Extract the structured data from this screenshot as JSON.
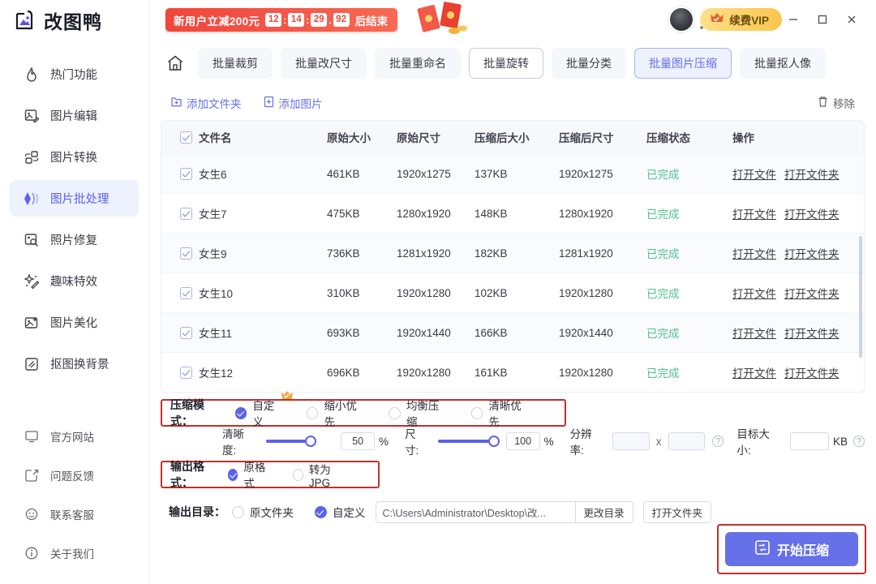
{
  "app": {
    "logo_text": "改图鸭"
  },
  "promo": {
    "text": "新用户立减200元",
    "hours": "12",
    "minutes": "14",
    "seconds": "29",
    "millis": "92",
    "sep": ":",
    "dot": ".",
    "end_text": "后结束"
  },
  "titlebar": {
    "vip_label": "续费VIP",
    "minimize": "—",
    "maximize": "▢",
    "close": "✕"
  },
  "sidebar": {
    "items": [
      {
        "label": "热门功能",
        "icon": "flame-icon",
        "active": false
      },
      {
        "label": "图片编辑",
        "icon": "image-edit-icon",
        "active": false
      },
      {
        "label": "图片转换",
        "icon": "image-convert-icon",
        "active": false
      },
      {
        "label": "图片批处理",
        "icon": "batch-process-icon",
        "active": true
      },
      {
        "label": "照片修复",
        "icon": "photo-repair-icon",
        "active": false
      },
      {
        "label": "趣味特效",
        "icon": "sparkle-icon",
        "active": false
      },
      {
        "label": "图片美化",
        "icon": "image-beautify-icon",
        "active": false
      },
      {
        "label": "抠图换背景",
        "icon": "cutout-icon",
        "active": false
      }
    ],
    "bottom_items": [
      {
        "label": "官方网站",
        "icon": "monitor-icon"
      },
      {
        "label": "问题反馈",
        "icon": "feedback-icon"
      },
      {
        "label": "联系客服",
        "icon": "headset-icon"
      },
      {
        "label": "关于我们",
        "icon": "info-icon"
      }
    ]
  },
  "tabs": {
    "home_icon": "home-icon",
    "items": [
      {
        "label": "批量裁剪",
        "state": "normal"
      },
      {
        "label": "批量改尺寸",
        "state": "normal"
      },
      {
        "label": "批量重命名",
        "state": "normal"
      },
      {
        "label": "批量旋转",
        "state": "outlined"
      },
      {
        "label": "批量分类",
        "state": "normal"
      },
      {
        "label": "批量图片压缩",
        "state": "active"
      },
      {
        "label": "批量抠人像",
        "state": "normal"
      }
    ]
  },
  "toolbar": {
    "add_folder": "添加文件夹",
    "add_image": "添加图片",
    "remove": "移除"
  },
  "table": {
    "headers": [
      "文件名",
      "原始大小",
      "原始尺寸",
      "压缩后大小",
      "压缩后尺寸",
      "压缩状态",
      "操作"
    ],
    "actions": {
      "open_file": "打开文件",
      "open_folder": "打开文件夹"
    },
    "rows": [
      {
        "name": "女生6",
        "orig_size": "461KB",
        "orig_dim": "1920x1275",
        "comp_size": "137KB",
        "comp_dim": "1920x1275",
        "status": "已完成"
      },
      {
        "name": "女生7",
        "orig_size": "475KB",
        "orig_dim": "1280x1920",
        "comp_size": "148KB",
        "comp_dim": "1280x1920",
        "status": "已完成"
      },
      {
        "name": "女生9",
        "orig_size": "736KB",
        "orig_dim": "1281x1920",
        "comp_size": "182KB",
        "comp_dim": "1281x1920",
        "status": "已完成"
      },
      {
        "name": "女生10",
        "orig_size": "310KB",
        "orig_dim": "1920x1280",
        "comp_size": "102KB",
        "comp_dim": "1920x1280",
        "status": "已完成"
      },
      {
        "name": "女生11",
        "orig_size": "693KB",
        "orig_dim": "1920x1440",
        "comp_size": "166KB",
        "comp_dim": "1920x1440",
        "status": "已完成"
      },
      {
        "name": "女生12",
        "orig_size": "696KB",
        "orig_dim": "1920x1280",
        "comp_size": "161KB",
        "comp_dim": "1920x1280",
        "status": "已完成"
      }
    ]
  },
  "settings": {
    "mode_label": "压缩模式：",
    "modes": [
      {
        "label": "自定义",
        "selected": true,
        "vip": true
      },
      {
        "label": "缩小优先",
        "selected": false
      },
      {
        "label": "均衡压缩",
        "selected": false
      },
      {
        "label": "清晰优先",
        "selected": false
      }
    ],
    "clarity_label": "清晰度:",
    "clarity_value": "50",
    "clarity_unit": "%",
    "size_label": "尺寸:",
    "size_value": "100",
    "size_unit": "%",
    "resolution_label": "分辨率:",
    "resolution_w": "",
    "resolution_h": "",
    "resolution_x": "x",
    "target_label": "目标大小:",
    "target_value": "",
    "target_unit": "KB",
    "help": "?",
    "format_label": "输出格式：",
    "formats": [
      {
        "label": "原格式",
        "selected": true
      },
      {
        "label": "转为JPG",
        "selected": false
      }
    ],
    "dir_label": "输出目录：",
    "dir_options": [
      {
        "label": "原文件夹",
        "selected": false
      },
      {
        "label": "自定义",
        "selected": true
      }
    ],
    "dir_path": "C:\\Users\\Administrator\\Desktop\\改...",
    "change_dir": "更改目录",
    "open_folder": "打开文件夹",
    "start_button": "开始压缩"
  },
  "colors": {
    "accent": "#6670e8",
    "promo_red": "#f0453a",
    "vip_gold": "#fcd26a",
    "status_green": "#4dc38a",
    "highlight_border": "#c0302a"
  }
}
